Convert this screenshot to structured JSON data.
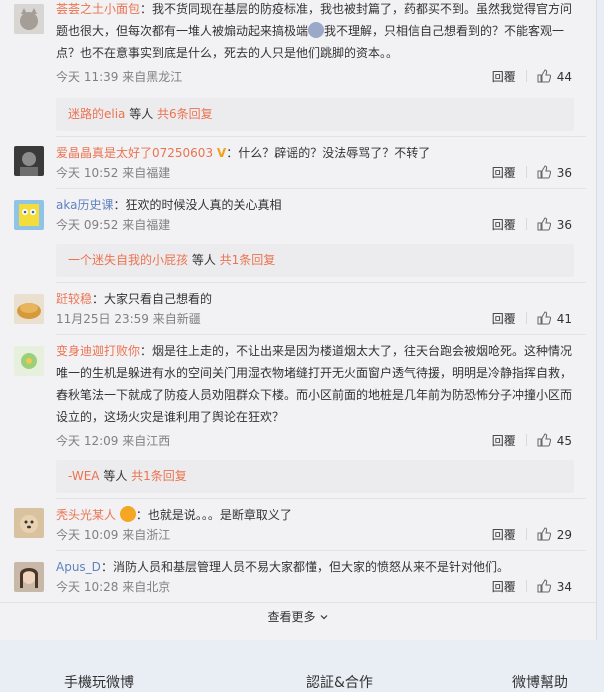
{
  "comments": [
    {
      "user": "荟荟之土小面包",
      "text_after": "：我不货同现在基层的防疫标准，我也被封篇了，药都买不到。虽然我觉得官方问题也很大，但每次都有一堆人被煽动起来搞极端",
      "text_tail": "我不理解，只相信自己想看到的？不能客观一点？也不在意事实到底是什么，死去的人只是他们跳脚的资本。。",
      "time": "今天 11:39 来自黑龙江",
      "reply": "回覆",
      "likes": "44"
    },
    {
      "user": "爱晶晶真是太好了07250603",
      "text_after": "：什么？辟谣的？没法辱骂了？不转了",
      "time": "今天 10:52 来自福建",
      "reply": "回覆",
      "likes": "36"
    },
    {
      "user": "aka历史课",
      "text_after": "：狂欢的时候没人真的关心真相",
      "time": "今天 09:52 来自福建",
      "reply": "回覆",
      "likes": "36"
    },
    {
      "user": "跹较稳",
      "text_after": "：大家只看自己想看的",
      "time": "11月25日 23:59 来自新疆",
      "reply": "回覆",
      "likes": "41"
    },
    {
      "user": "变身迪迦打败你",
      "text_after": "：烟是往上走的，不让出来是因为楼道烟太大了，往天台跑会被烟呛死。这种情况唯一的生机是躲进有水的空间关门用湿衣物堵缝打开无火面窗户透气待援，明明是冷静指挥自救，舂秋笔法一下就成了防疫人员劝阻群众下楼。而小区前面的地桩是几年前为防恐怖分子冲撞小区而设立的，这场火灾是谁利用了舆论在狂欢？",
      "time": "今天 12:09 来自江西",
      "reply": "回覆",
      "likes": "45"
    },
    {
      "user": "秃头光某人",
      "text_after": "：也就是说。。。是断章取义了",
      "time": "今天 10:09 来自浙江",
      "reply": "回覆",
      "likes": "29"
    },
    {
      "user": "Apus_D",
      "text_after": "：消防人员和基层管理人员不易大家都懂，但大家的愤怒从来不是针对他们。",
      "time": "今天 10:28 来自北京",
      "reply": "回覆",
      "likes": "34"
    }
  ],
  "subreplies": [
    {
      "name": "迷路的elia",
      "mid": " 等人 ",
      "count": "共6条回复"
    },
    {
      "name": "一个迷失自我的小屁孩",
      "mid": " 等人 ",
      "count": "共1条回复"
    },
    {
      "name": "-WEA",
      "mid": " 等人 ",
      "count": "共1条回复"
    }
  ],
  "more_label": "查看更多",
  "footer": [
    "手機玩微博",
    "認証&合作",
    "微博幫助"
  ],
  "colors": {
    "accent": "#eb7350",
    "link": "#5f82c0",
    "bg": "#f2f2f5"
  }
}
